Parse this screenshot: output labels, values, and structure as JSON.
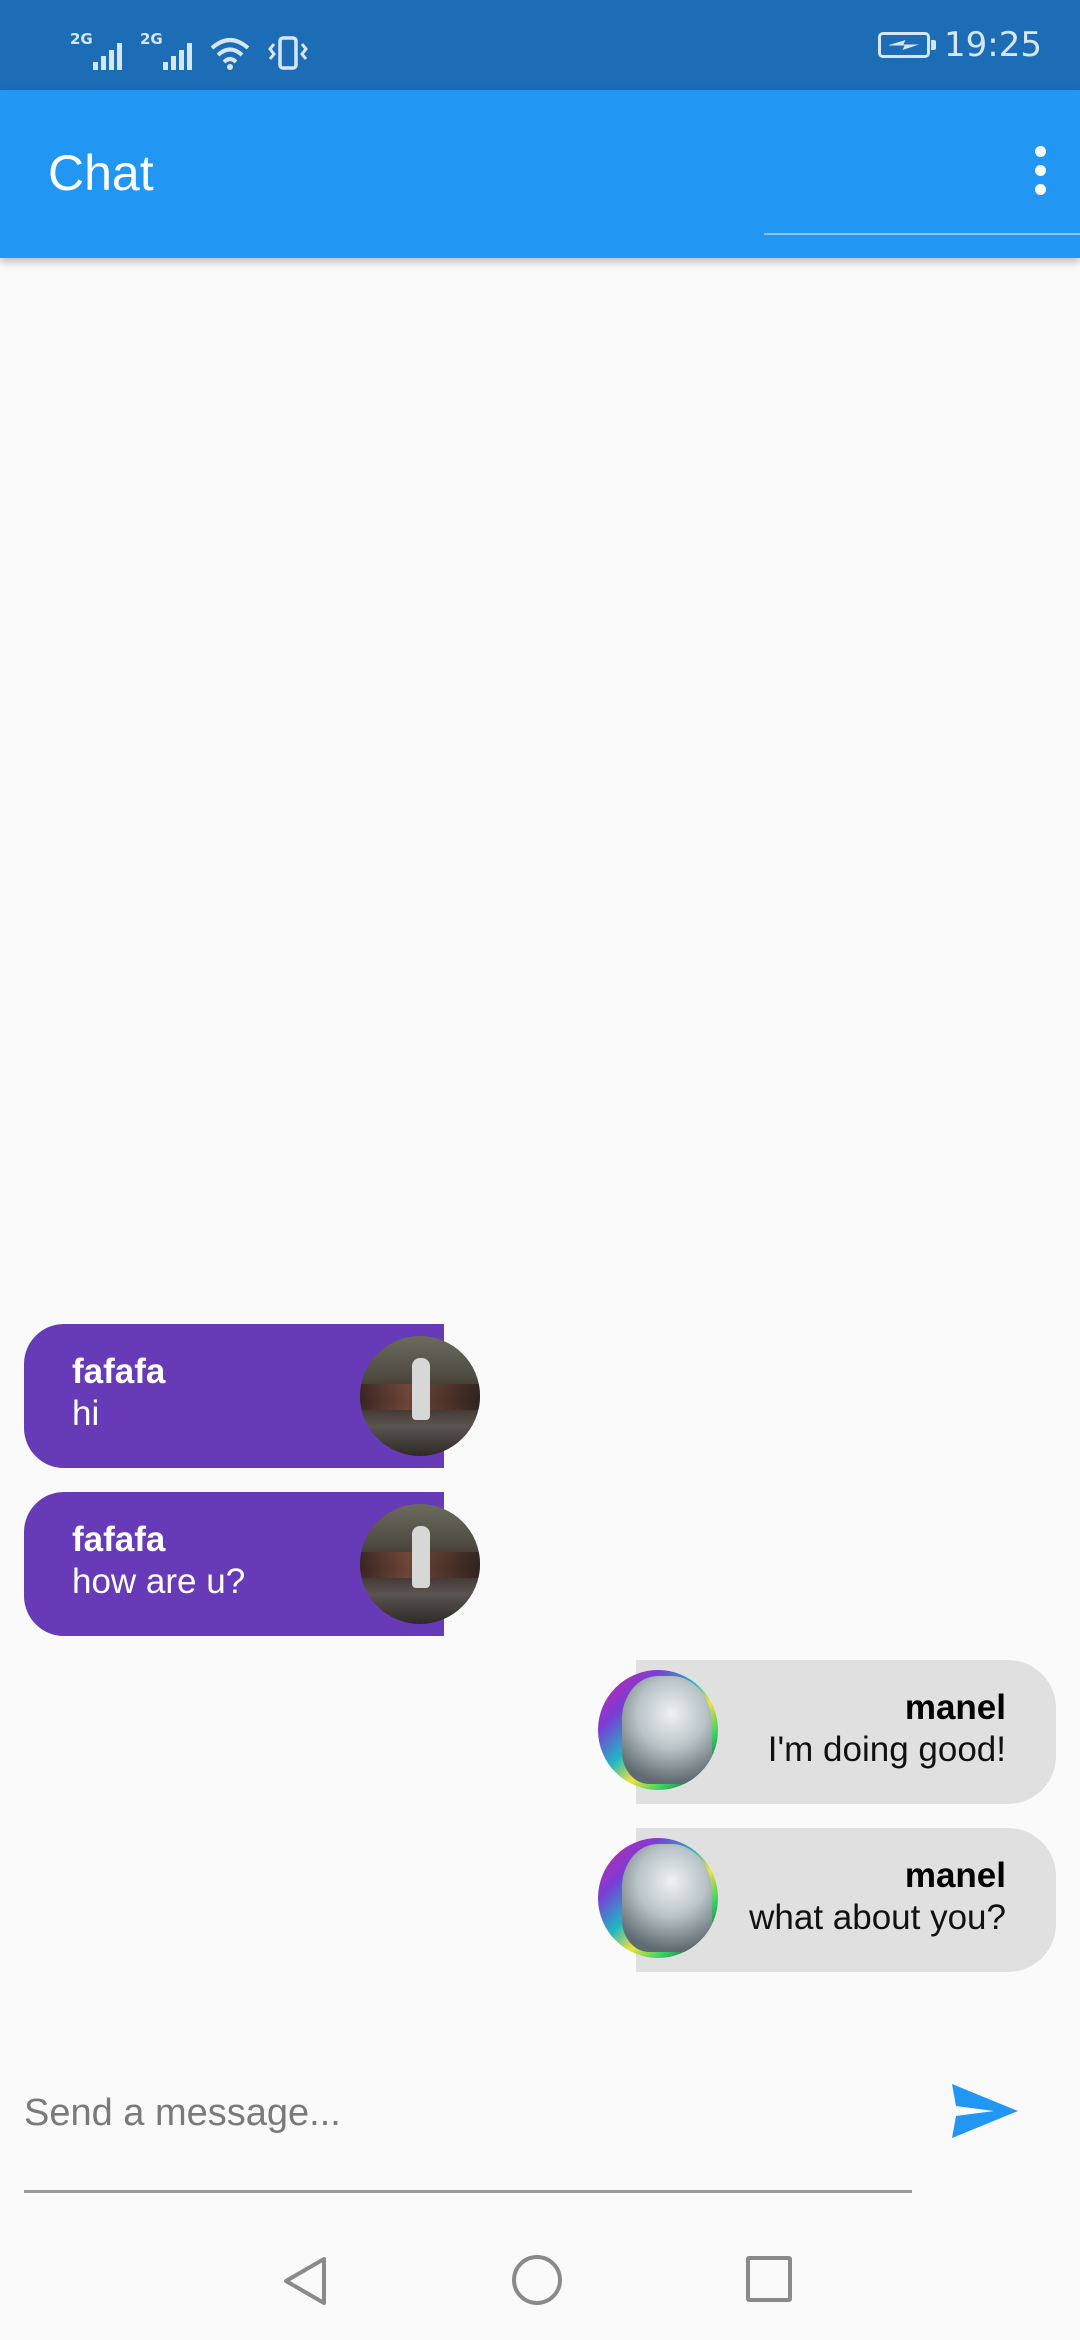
{
  "status_bar": {
    "sim1_label": "2G",
    "sim2_label": "2G",
    "time": "19:25",
    "icons": [
      "signal-icon",
      "signal-icon",
      "wifi-icon",
      "vibrate-icon",
      "battery-charging-icon"
    ]
  },
  "app_bar": {
    "title": "Chat",
    "menu_icon": "more-vert-icon",
    "color": "#2196f3"
  },
  "messages": [
    {
      "sender": "fafafa",
      "text": "hi",
      "side": "left",
      "bubble_color": "#673ab7"
    },
    {
      "sender": "fafafa",
      "text": "how are u?",
      "side": "left",
      "bubble_color": "#673ab7"
    },
    {
      "sender": "manel",
      "text": "I'm doing good!",
      "side": "right",
      "bubble_color": "#e0e0e0"
    },
    {
      "sender": "manel",
      "text": "what about you?",
      "side": "right",
      "bubble_color": "#e0e0e0"
    }
  ],
  "composer": {
    "placeholder": "Send a message...",
    "value": "",
    "send_icon": "send-icon"
  },
  "nav_bar": {
    "icons": [
      "back-icon",
      "home-icon",
      "recents-icon"
    ]
  }
}
